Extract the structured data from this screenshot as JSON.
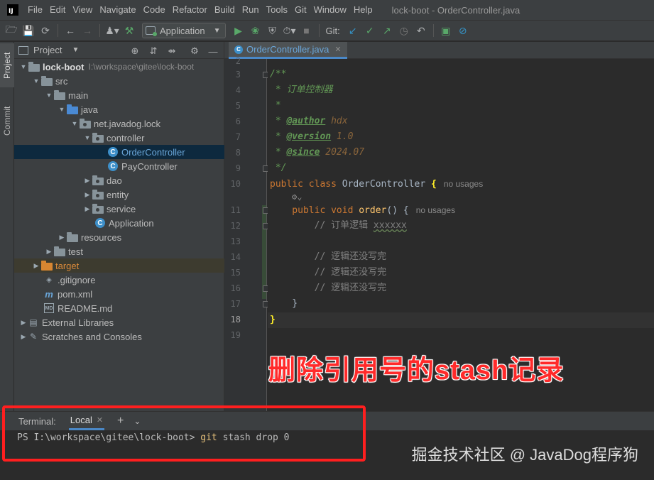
{
  "menu": {
    "items": [
      "File",
      "Edit",
      "View",
      "Navigate",
      "Code",
      "Refactor",
      "Build",
      "Run",
      "Tools",
      "Git",
      "Window",
      "Help"
    ],
    "window_title": "lock-boot - OrderController.java"
  },
  "toolbar": {
    "run_config": "Application",
    "git_label": "Git:"
  },
  "stripe": {
    "project": "Project",
    "commit": "Commit"
  },
  "project_panel": {
    "title": "Project",
    "tree": [
      {
        "label": "lock-boot",
        "path": "I:\\workspace\\gitee\\lock-boot"
      },
      {
        "label": "src"
      },
      {
        "label": "main"
      },
      {
        "label": "java"
      },
      {
        "label": "net.javadog.lock"
      },
      {
        "label": "controller"
      },
      {
        "label": "OrderController"
      },
      {
        "label": "PayController"
      },
      {
        "label": "dao"
      },
      {
        "label": "entity"
      },
      {
        "label": "service"
      },
      {
        "label": "Application"
      },
      {
        "label": "resources"
      },
      {
        "label": "test"
      },
      {
        "label": "target"
      },
      {
        "label": ".gitignore"
      },
      {
        "label": "pom.xml"
      },
      {
        "label": "README.md"
      },
      {
        "label": "External Libraries"
      },
      {
        "label": "Scratches and Consoles"
      }
    ],
    "icons": {
      "class_letter": "C",
      "maven_letter": "m",
      "md_letter": "MD"
    }
  },
  "editor": {
    "tab_label": "OrderController.java",
    "line_numbers": [
      "2",
      "3",
      "4",
      "5",
      "6",
      "7",
      "8",
      "9",
      "10",
      "11",
      "12",
      "13",
      "14",
      "15",
      "16",
      "17",
      "18",
      "19"
    ],
    "current_line": "18",
    "lines": {
      "l3": "/**",
      "l4": " * 订单控制器",
      "l5": " *",
      "l6_star": " * ",
      "l6_tag": "@author",
      "l6_val": " hdx",
      "l7_star": " * ",
      "l7_tag": "@version",
      "l7_val": " 1.0",
      "l8_star": " * ",
      "l8_tag": "@since",
      "l8_val": " 2024.07",
      "l9": " */",
      "l10_kw": "public class ",
      "l10_cls": "OrderController ",
      "l10_brace": "{",
      "l10_hint": "no usages",
      "l11_kw": "    public void ",
      "l11_fn": "order",
      "l11_rest": "() {",
      "l11_hint": "no usages",
      "l12_prefix": "        // 订单逻辑 ",
      "l12_sq": "xxxxxx",
      "l14": "        // 逻辑还没写完",
      "l15": "        // 逻辑还没写完",
      "l16": "        // 逻辑还没写完",
      "l17": "    }",
      "l18": "}"
    },
    "overlay_title": "删除引用号的stash记录"
  },
  "terminal": {
    "title": "Terminal:",
    "tab_label": "Local",
    "prompt": "PS I:\\workspace\\gitee\\lock-boot> ",
    "command": "git",
    "args": " stash drop 0"
  },
  "watermark": "掘金技术社区 @ JavaDog程序狗",
  "colors": {
    "accent": "#4a88c7",
    "highlight_box": "#ff1f1f",
    "overlay_text": "#ff2a2a"
  }
}
